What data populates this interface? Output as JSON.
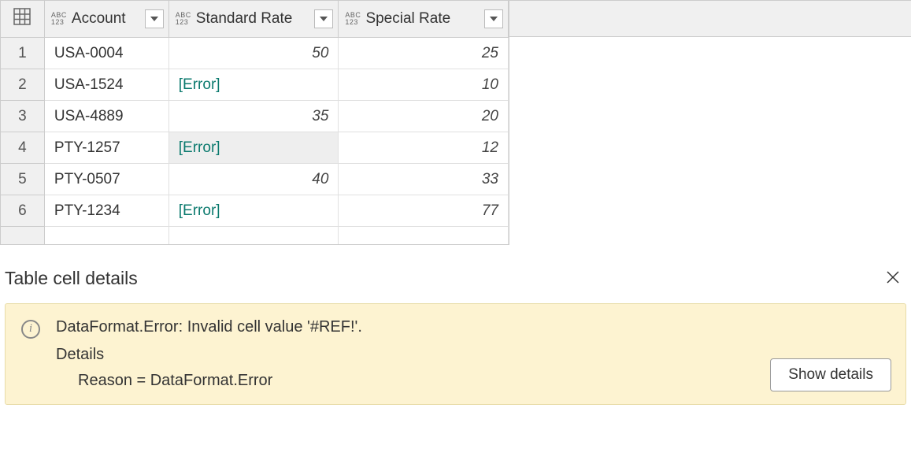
{
  "columns": {
    "type_abc": "ABC",
    "type_123": "123",
    "account": "Account",
    "standard_rate": "Standard Rate",
    "special_rate": "Special Rate"
  },
  "rows": [
    {
      "num": "1",
      "account": "USA-0004",
      "standard": "50",
      "std_error": false,
      "special": "25"
    },
    {
      "num": "2",
      "account": "USA-1524",
      "standard": "[Error]",
      "std_error": true,
      "special": "10"
    },
    {
      "num": "3",
      "account": "USA-4889",
      "standard": "35",
      "std_error": false,
      "special": "20"
    },
    {
      "num": "4",
      "account": "PTY-1257",
      "standard": "[Error]",
      "std_error": true,
      "special": "12",
      "selected": true
    },
    {
      "num": "5",
      "account": "PTY-0507",
      "standard": "40",
      "std_error": false,
      "special": "33"
    },
    {
      "num": "6",
      "account": "PTY-1234",
      "standard": "[Error]",
      "std_error": true,
      "special": "77"
    }
  ],
  "details": {
    "title": "Table cell details",
    "error_message": "DataFormat.Error: Invalid cell value '#REF!'.",
    "details_label": "Details",
    "reason_line": "Reason = DataFormat.Error",
    "show_details_btn": "Show details"
  }
}
